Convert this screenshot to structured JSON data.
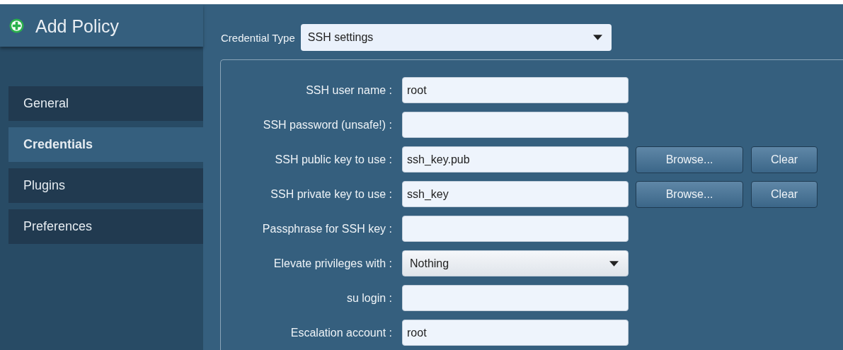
{
  "header": {
    "title": "Add Policy"
  },
  "sidebar": {
    "items": [
      {
        "label": "General",
        "selected": false
      },
      {
        "label": "Credentials",
        "selected": true
      },
      {
        "label": "Plugins",
        "selected": false
      },
      {
        "label": "Preferences",
        "selected": false
      }
    ]
  },
  "credential_type": {
    "label": "Credential Type",
    "value": "SSH settings"
  },
  "fields": [
    {
      "kind": "text",
      "label": "SSH user name :",
      "value": "root"
    },
    {
      "kind": "text",
      "label": "SSH password (unsafe!) :"
    },
    {
      "kind": "text",
      "label": "SSH public key to use :",
      "value": "ssh_key.pub",
      "buttons": [
        "Browse...",
        "Clear"
      ]
    },
    {
      "kind": "text",
      "label": "SSH private key to use :",
      "value": "ssh_key",
      "buttons": [
        "Browse...",
        "Clear"
      ]
    },
    {
      "kind": "text",
      "label": "Passphrase for SSH key :"
    },
    {
      "kind": "select",
      "label": "Elevate privileges with :",
      "value": "Nothing"
    },
    {
      "kind": "text",
      "label": "su login :"
    },
    {
      "kind": "text",
      "label": "Escalation account :",
      "value": "root"
    }
  ]
}
